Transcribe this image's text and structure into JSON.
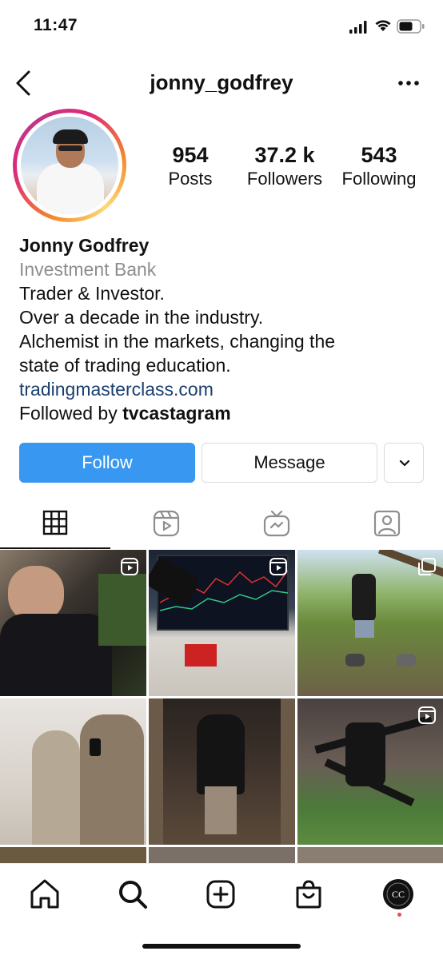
{
  "status_bar": {
    "time": "11:47"
  },
  "header": {
    "username": "jonny_godfrey"
  },
  "profile": {
    "stats": [
      {
        "value": "954",
        "label": "Posts"
      },
      {
        "value": "37.2 k",
        "label": "Followers"
      },
      {
        "value": "543",
        "label": "Following"
      }
    ],
    "name": "Jonny Godfrey",
    "category": "Investment Bank",
    "bio_lines": [
      "Trader & Investor.",
      "Over a decade in the industry.",
      "Alchemist in the markets, changing the",
      "state of trading education."
    ],
    "link": "tradingmasterclass.com",
    "followed_by_prefix": "Followed by ",
    "followed_by_user": "tvcastagram"
  },
  "actions": {
    "follow_label": "Follow",
    "message_label": "Message"
  },
  "tabs": [
    {
      "name": "grid",
      "icon": "grid-icon",
      "active": true
    },
    {
      "name": "reels",
      "icon": "reels-icon",
      "active": false
    },
    {
      "name": "igtv",
      "icon": "igtv-icon",
      "active": false
    },
    {
      "name": "tagged",
      "icon": "tagged-icon",
      "active": false
    }
  ],
  "bottom_nav": [
    "home-icon",
    "search-icon",
    "new-post-icon",
    "shop-icon",
    "profile-avatar"
  ],
  "colors": {
    "accent": "#3897f0",
    "link": "#1a3f6e",
    "muted": "#8e8e8e",
    "notification": "#ed4956"
  }
}
